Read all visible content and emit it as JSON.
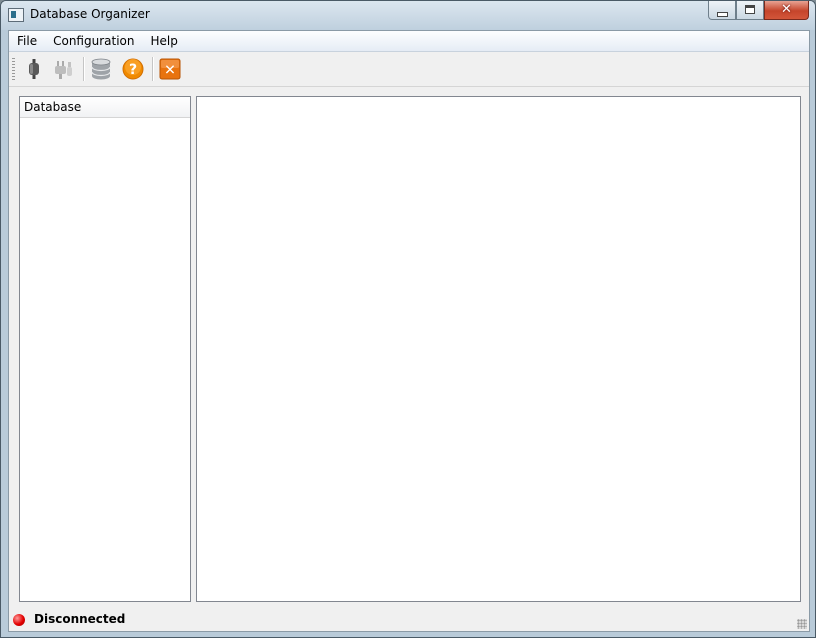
{
  "window": {
    "title": "Database Organizer",
    "close_glyph": "✕"
  },
  "menu": {
    "items": [
      "File",
      "Configuration",
      "Help"
    ]
  },
  "toolbar": {
    "buttons": [
      {
        "icon": "plug-connect-icon"
      },
      {
        "icon": "plug-disconnect-icon"
      },
      {
        "icon": "database-icon"
      },
      {
        "icon": "help-icon",
        "glyph": "?"
      },
      {
        "icon": "exit-icon",
        "glyph": "✕"
      }
    ]
  },
  "tree": {
    "header": "Database"
  },
  "status": {
    "text": "Disconnected",
    "color": "#e30000"
  }
}
